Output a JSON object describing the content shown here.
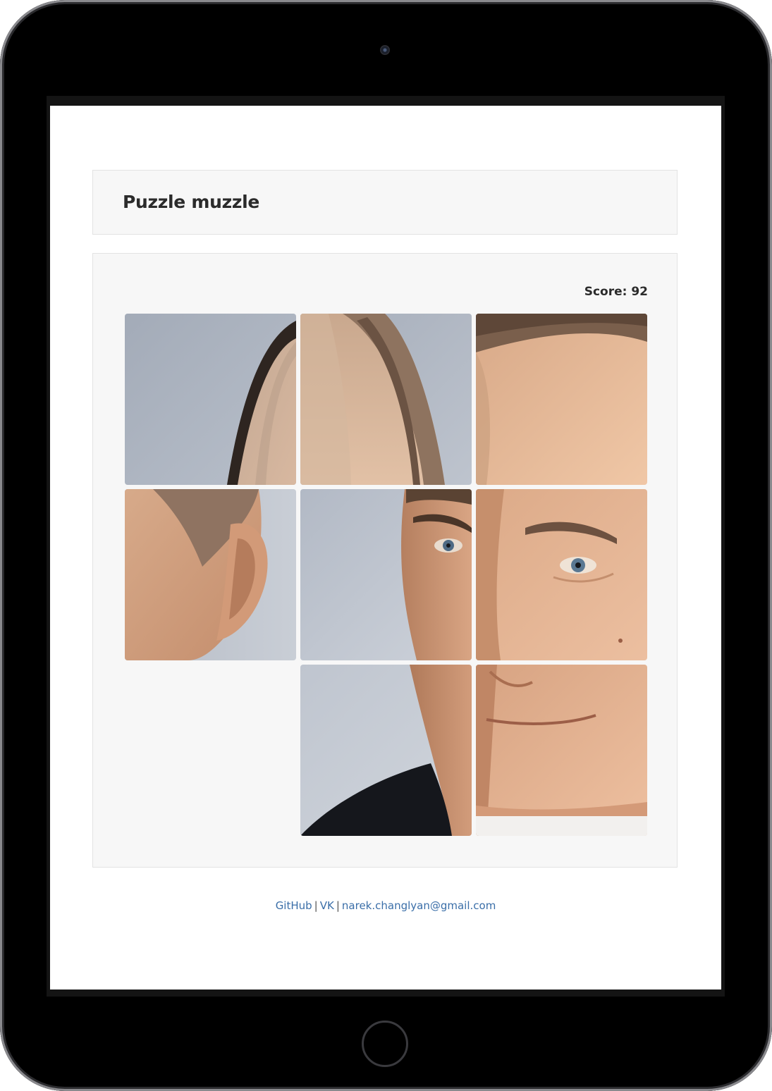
{
  "header": {
    "title": "Puzzle muzzle"
  },
  "game": {
    "score_text": "Score: 92",
    "grid_size": 3,
    "empty_position": [
      2,
      0
    ],
    "tiles": [
      {
        "row": 0,
        "col": 0,
        "name": "tile-hair-left",
        "depicts": "top-left of head, hairline against grey background"
      },
      {
        "row": 0,
        "col": 1,
        "name": "tile-hair-top",
        "depicts": "top of head with thinning hair"
      },
      {
        "row": 0,
        "col": 2,
        "name": "tile-forehead",
        "depicts": "forehead and hair"
      },
      {
        "row": 1,
        "col": 0,
        "name": "tile-ear",
        "depicts": "ear and side of head"
      },
      {
        "row": 1,
        "col": 1,
        "name": "tile-left-eye",
        "depicts": "left eye and cheek edge"
      },
      {
        "row": 1,
        "col": 2,
        "name": "tile-right-eye",
        "depicts": "right eye and cheek"
      },
      {
        "row": 2,
        "col": 1,
        "name": "tile-jaw-suit",
        "depicts": "jaw edge and dark suit shoulder"
      },
      {
        "row": 2,
        "col": 2,
        "name": "tile-mouth-chin",
        "depicts": "nose, smile and chin"
      }
    ]
  },
  "footer": {
    "links": [
      {
        "label": "GitHub"
      },
      {
        "label": "VK"
      },
      {
        "label": "narek.changlyan@gmail.com"
      }
    ],
    "separator": "|"
  },
  "colors": {
    "panel_bg": "#f7f7f7",
    "panel_border": "#e3e3e3",
    "link": "#3a6ea8",
    "title": "#2b2b2b"
  }
}
